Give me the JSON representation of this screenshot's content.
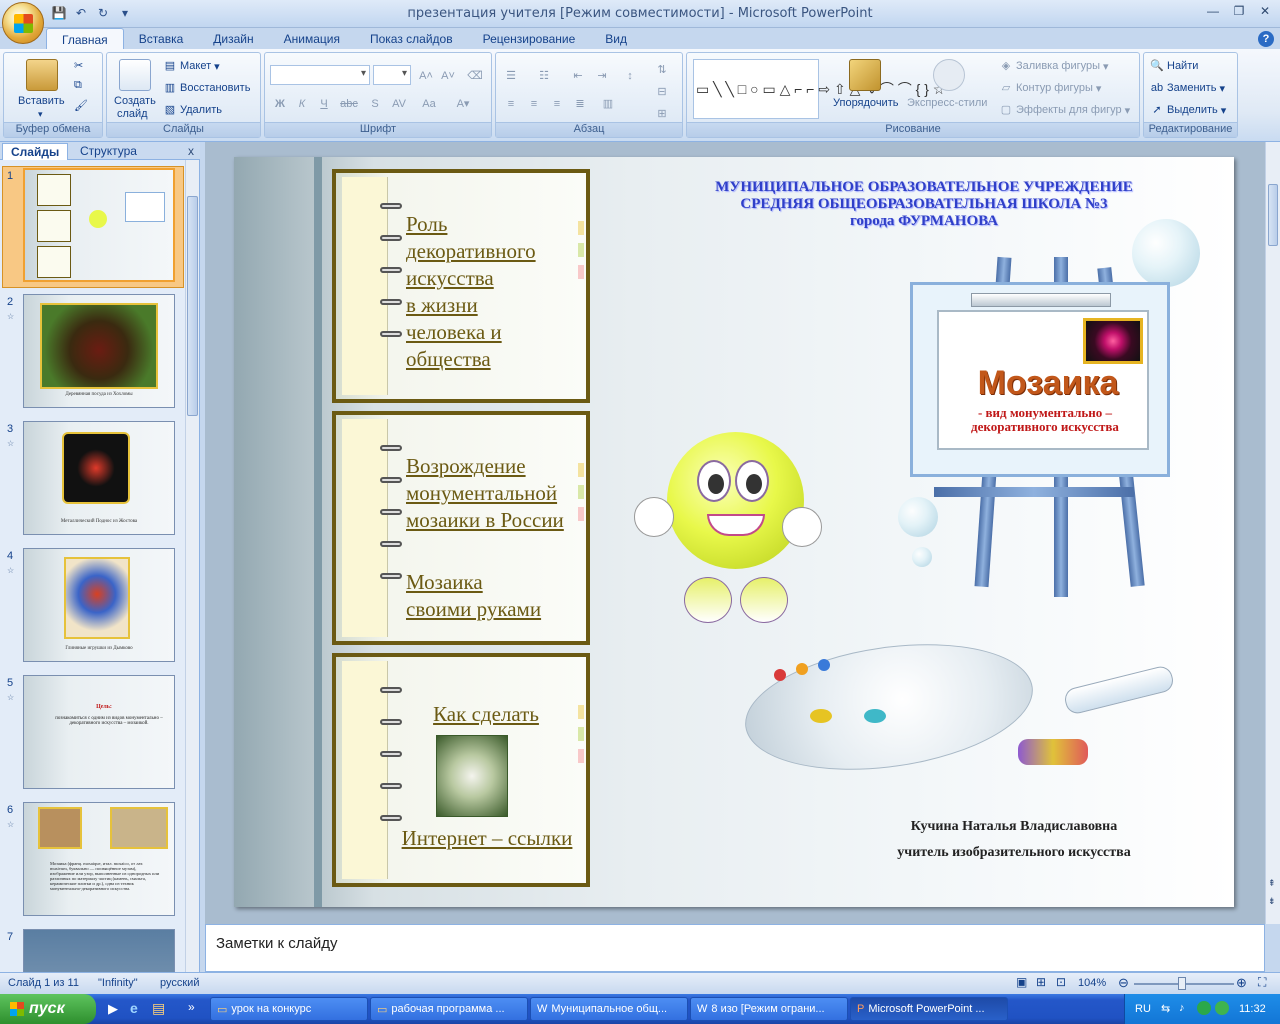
{
  "app": {
    "window_title": "презентация учителя [Режим совместимости] - Microsoft PowerPoint"
  },
  "ribbon": {
    "tabs": [
      "Главная",
      "Вставка",
      "Дизайн",
      "Анимация",
      "Показ слайдов",
      "Рецензирование",
      "Вид"
    ],
    "groups": {
      "clipboard": {
        "label": "Буфер обмена",
        "paste": "Вставить"
      },
      "slides": {
        "label": "Слайды",
        "create": "Создать",
        "create2": "слайд",
        "layout": "Макет",
        "reset": "Восстановить",
        "delete": "Удалить"
      },
      "font": {
        "label": "Шрифт",
        "font_name": "",
        "font_size": ""
      },
      "paragraph": {
        "label": "Абзац"
      },
      "drawing": {
        "label": "Рисование",
        "arrange": "Упорядочить",
        "quick_styles": "Экспресс-стили",
        "fill": "Заливка фигуры",
        "outline": "Контур фигуры",
        "effects": "Эффекты для фигур"
      },
      "editing": {
        "label": "Редактирование",
        "find": "Найти",
        "replace": "Заменить",
        "select": "Выделить"
      }
    }
  },
  "left_pane": {
    "tab_slides": "Слайды",
    "tab_outline": "Структура",
    "close": "x",
    "thumbs": [
      {
        "num": "1",
        "caption": ""
      },
      {
        "num": "2",
        "caption": "Деревянная посуда из Хохломы"
      },
      {
        "num": "3",
        "caption": "Металлический Поднос из Жостова"
      },
      {
        "num": "4",
        "caption": "Глиняные игрушки из Дымково"
      },
      {
        "num": "5",
        "caption": "познакомиться с одним из видов монументально – декоративного искусства – мозаикой.",
        "heading": "Цель:"
      },
      {
        "num": "6",
        "caption": "Мозаика (франц. mosaique, итал. mosaico, от лат. musivum, буквально — посвящённое музам), изображение или узор, выполненные из однородных или различных по материалу частиц (камень, смальта, керамические плитки и др.), одна из техник монументально-декоративного искусства."
      },
      {
        "num": "7",
        "caption": ""
      }
    ]
  },
  "slide": {
    "title": "МУНИЦИПАЛЬНОЕ ОБРАЗОВАТЕЛЬНОЕ УЧРЕЖДЕНИЕ\nСРЕДНЯЯ ОБЩЕОБРАЗОВАТЕЛЬНАЯ ШКОЛА №3\nгорода ФУРМАНОВА",
    "nb1": "Роль\nдекоративного\nискусства\nв жизни\nчеловека и\nобщества",
    "nb2a": "Возрождение\nмонументальной\nмозаики в России",
    "nb2b": "Мозаика\nсвоими руками",
    "nb3a": "Как сделать",
    "nb3b": "Интернет – ссылки",
    "board_title": "Мозаика",
    "board_sub": "- вид монументально –\nдекоративного искусства",
    "author_name": "Кучина Наталья Владиславовна",
    "author_role": "учитель изобразительного искусства"
  },
  "notes": {
    "placeholder": "Заметки к слайду"
  },
  "status": {
    "slide": "Слайд 1 из 11",
    "theme": "\"Infinity\"",
    "lang": "русский",
    "zoom": "104%"
  },
  "taskbar": {
    "start": "пуск",
    "tasks": [
      "урок на конкурс",
      "рабочая программа ...",
      "Муниципальное общ...",
      "8 изо [Режим ограни...",
      "Microsoft PowerPoint ..."
    ],
    "lang": "RU",
    "clock": "11:32"
  },
  "colors": {
    "accent": "#15428b",
    "notebook_border": "#6b5a13",
    "title_blue": "#2f3fc8",
    "mozaika": "#c2571a"
  }
}
